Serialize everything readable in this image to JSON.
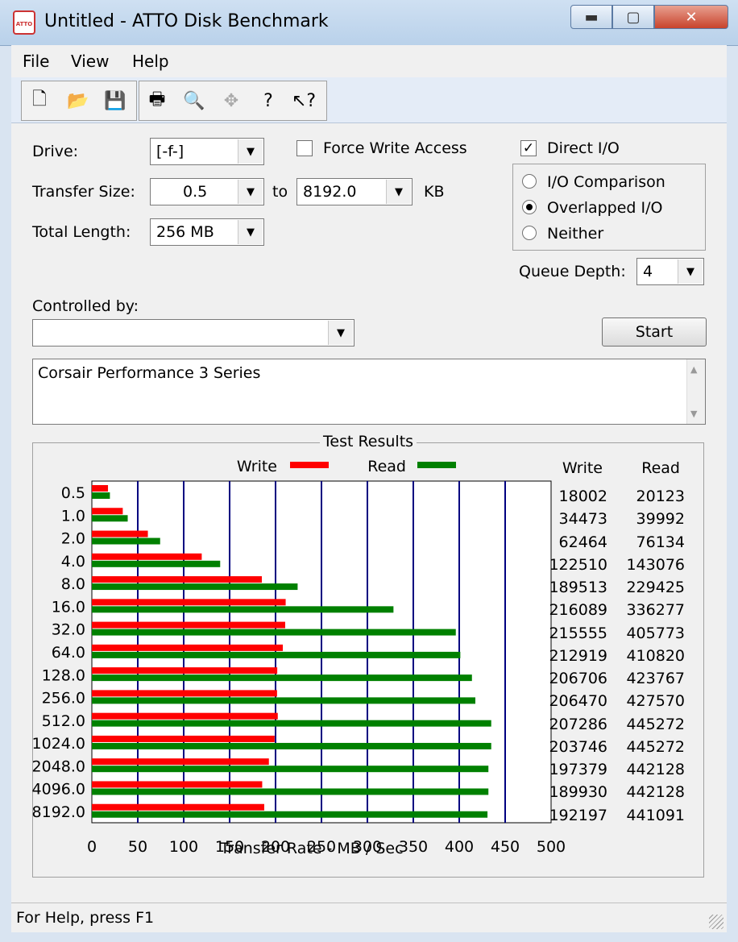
{
  "window": {
    "title": "Untitled - ATTO Disk Benchmark",
    "icon": "atto-icon"
  },
  "menu": [
    "File",
    "View",
    "Help"
  ],
  "toolbar": [
    "new-icon",
    "open-icon",
    "save-icon",
    "print-icon",
    "print-preview-icon",
    "move-icon",
    "help-icon",
    "context-help-icon"
  ],
  "form": {
    "drive_label": "Drive:",
    "drive_value": "[-f-]",
    "transfer_label": "Transfer Size:",
    "transfer_from": "0.5",
    "to_label": "to",
    "transfer_to": "8192.0",
    "kb_label": "KB",
    "length_label": "Total Length:",
    "length_value": "256 MB",
    "force_write_label": "Force Write Access",
    "force_write_checked": false,
    "direct_io_label": "Direct I/O",
    "direct_io_checked": true,
    "io_comparison_label": "I/O Comparison",
    "overlapped_label": "Overlapped I/O",
    "neither_label": "Neither",
    "io_mode_selected": "Overlapped I/O",
    "queue_label": "Queue Depth:",
    "queue_value": "4",
    "controlled_label": "Controlled by:",
    "controlled_value": "",
    "start_label": "Start",
    "description": "Corsair Performance 3 Series"
  },
  "results": {
    "group_title": "Test Results",
    "write_col": "Write",
    "read_col": "Read"
  },
  "chart_data": {
    "type": "bar",
    "orientation": "horizontal",
    "categories": [
      "0.5",
      "1.0",
      "2.0",
      "4.0",
      "8.0",
      "16.0",
      "32.0",
      "64.0",
      "128.0",
      "256.0",
      "512.0",
      "1024.0",
      "2048.0",
      "4096.0",
      "8192.0"
    ],
    "series": [
      {
        "name": "Write",
        "color": "#ff0000",
        "values": [
          18002,
          34473,
          62464,
          122510,
          189513,
          216089,
          215555,
          212919,
          206706,
          206470,
          207286,
          203746,
          197379,
          189930,
          192197
        ]
      },
      {
        "name": "Read",
        "color": "#008000",
        "values": [
          20123,
          39992,
          76134,
          143076,
          229425,
          336277,
          405773,
          410820,
          423767,
          427570,
          445272,
          445272,
          442128,
          442128,
          441091
        ]
      }
    ],
    "xlabel": "Transfer Rate - MB / Sec",
    "xlim": [
      0,
      500
    ],
    "xticks": [
      "0",
      "50",
      "100",
      "150",
      "200",
      "250",
      "300",
      "350",
      "400",
      "450",
      "500"
    ],
    "value_units": "KB/s",
    "grid": true,
    "legend": "top"
  },
  "status": {
    "text": "For Help, press F1"
  }
}
